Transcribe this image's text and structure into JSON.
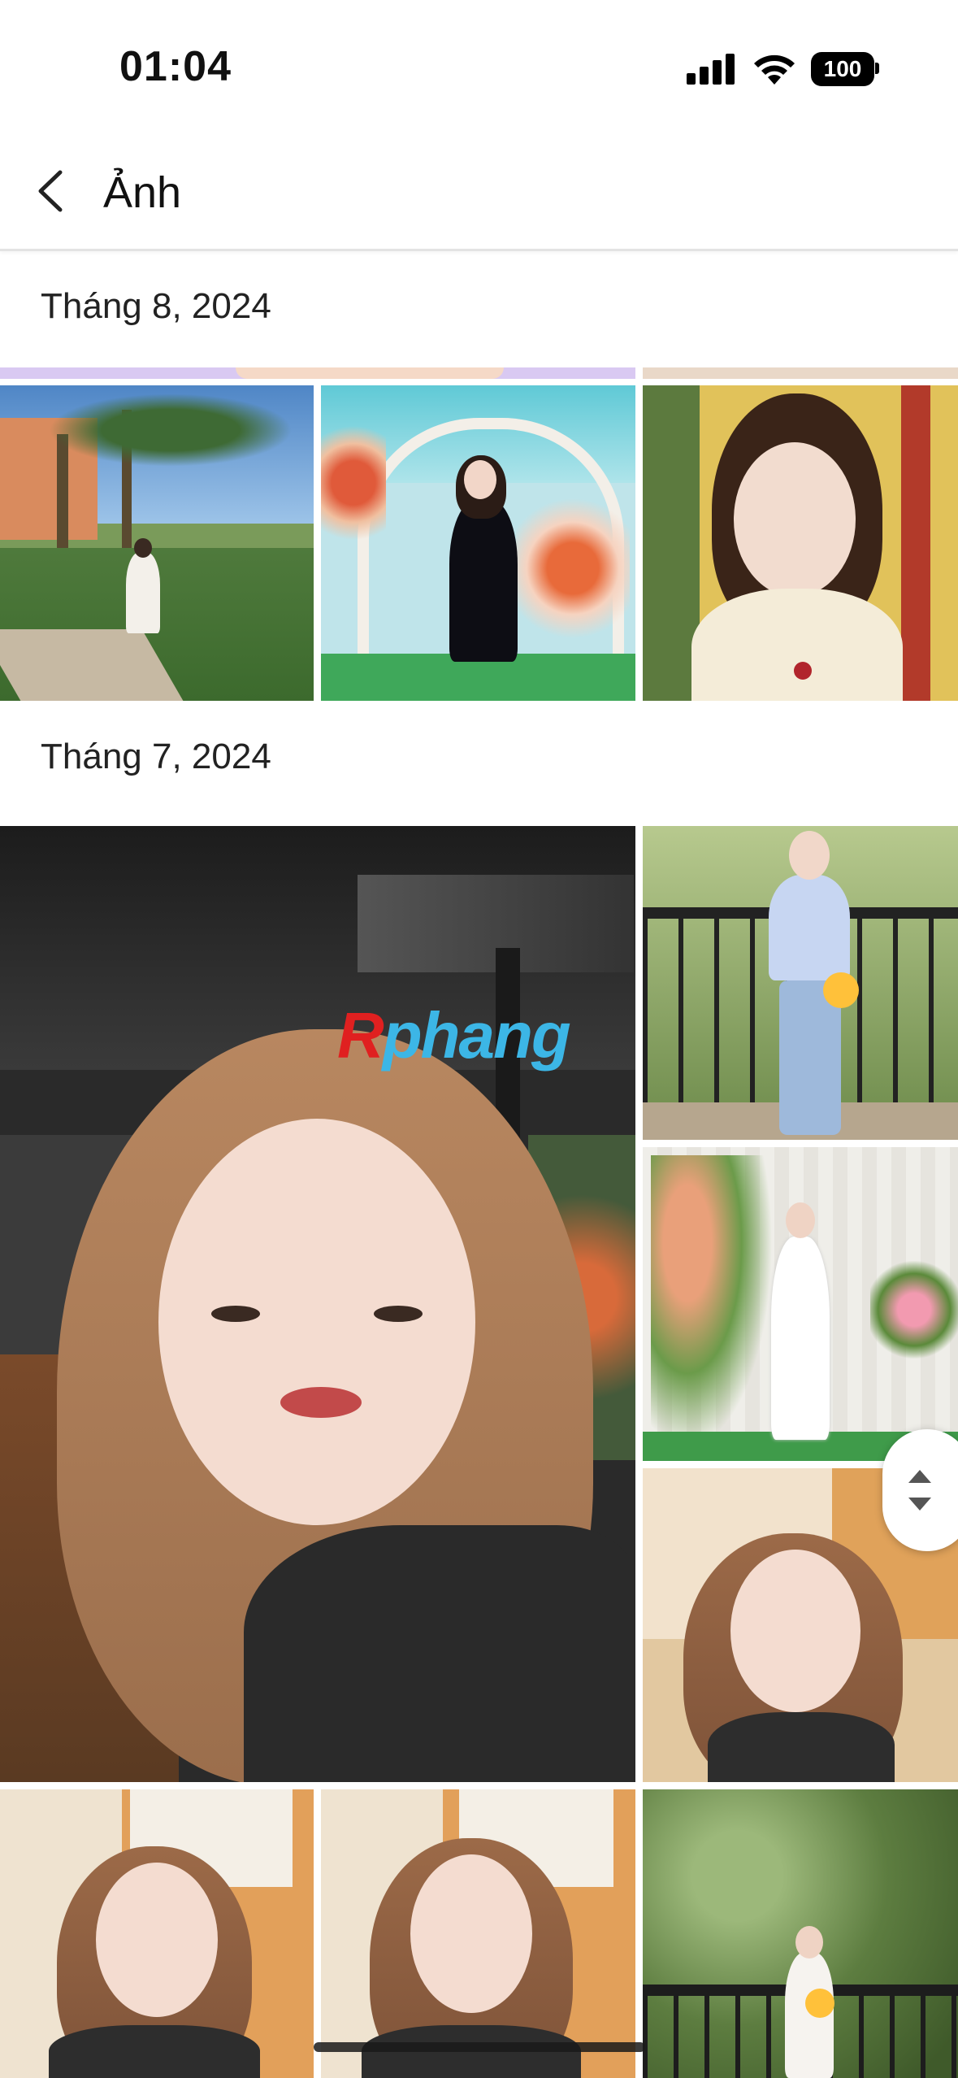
{
  "status_bar": {
    "time": "01:04",
    "battery": "100"
  },
  "header": {
    "title": "Ảnh"
  },
  "sections": [
    {
      "title": "Tháng 8, 2024"
    },
    {
      "title": "Tháng 7, 2024"
    }
  ],
  "watermark": {
    "first": "R",
    "rest": "phang"
  }
}
